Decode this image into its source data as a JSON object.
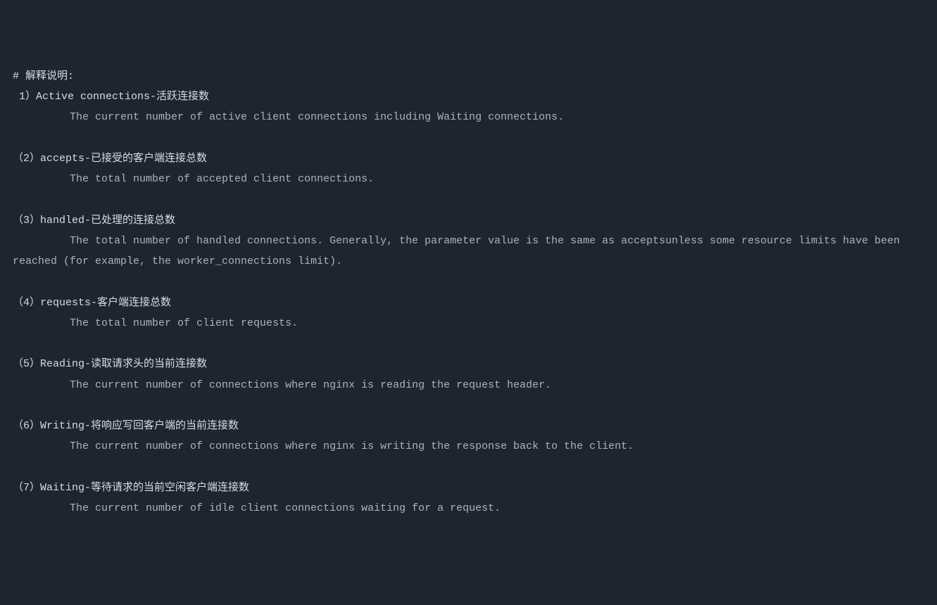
{
  "header": "# 解释说明:",
  "items": [
    {
      "num": " 1）",
      "title": "Active connections-活跃连接数",
      "desc": "         The current number of active client connections including Waiting connections."
    },
    {
      "num": "（2）",
      "title": "accepts-已接受的客户端连接总数",
      "desc": "         The total number of accepted client connections."
    },
    {
      "num": "（3）",
      "title": "handled-已处理的连接总数",
      "desc": "         The total number of handled connections. Generally, the parameter value is the same as acceptsunless some resource limits have been reached (for example, the worker_connections limit)."
    },
    {
      "num": "（4）",
      "title": "requests-客户端连接总数",
      "desc": "         The total number of client requests."
    },
    {
      "num": "（5）",
      "title": "Reading-读取请求头的当前连接数",
      "desc": "         The current number of connections where nginx is reading the request header."
    },
    {
      "num": "（6）",
      "title": "Writing-将响应写回客户端的当前连接数",
      "desc": "         The current number of connections where nginx is writing the response back to the client."
    },
    {
      "num": "（7）",
      "title": "Waiting-等待请求的当前空闲客户端连接数",
      "desc": "         The current number of idle client connections waiting for a request."
    }
  ]
}
